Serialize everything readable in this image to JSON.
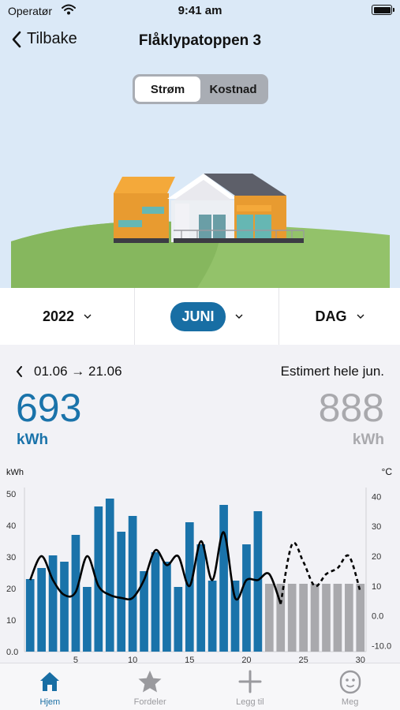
{
  "status": {
    "carrier": "Operatør",
    "time": "9:41 am"
  },
  "nav": {
    "back_label": "Tilbake",
    "title": "Flåklypatoppen 3"
  },
  "view_toggle": {
    "options": [
      "Strøm",
      "Kostnad"
    ],
    "selected": "Strøm"
  },
  "period": {
    "year": "2022",
    "month": "JUNI",
    "resolution": "DAG"
  },
  "summary": {
    "range": "01.06 → 21.06",
    "estimate_label": "Estimert hele jun.",
    "value": "693",
    "unit": "kWh",
    "estimate_value": "888",
    "estimate_unit": "kWh"
  },
  "colors": {
    "accent": "#186ea4",
    "bar_actual": "#1a73aa",
    "bar_estimate": "#a9a9ad",
    "temperature": "#000000"
  },
  "chart_data": {
    "type": "bar",
    "ylabel": "kWh",
    "y2label": "°C",
    "ylim": [
      0,
      52
    ],
    "y2lim": [
      -12,
      43
    ],
    "yticks": [
      "0.0",
      "10",
      "20",
      "30",
      "40",
      "50"
    ],
    "y2ticks": [
      "-10.0",
      "0.0",
      "10",
      "20",
      "30",
      "40"
    ],
    "xticks": [
      "5",
      "10",
      "15",
      "20",
      "25",
      "30"
    ],
    "days": [
      1,
      2,
      3,
      4,
      5,
      6,
      7,
      8,
      9,
      10,
      11,
      12,
      13,
      14,
      15,
      16,
      17,
      18,
      19,
      20,
      21,
      22,
      23,
      24,
      25,
      26,
      27,
      28,
      29,
      30
    ],
    "series": [
      {
        "name": "kWh",
        "values": [
          23,
          26.5,
          30.5,
          28.5,
          37,
          20.5,
          46,
          48.5,
          38,
          43,
          25.5,
          31.5,
          28.5,
          20.5,
          41,
          34,
          22.5,
          46.5,
          22.5,
          34,
          44.5
        ]
      },
      {
        "name": "Estimert",
        "values": [
          21.5,
          21.5,
          21.5,
          21.5,
          21.5,
          21.5,
          21.5,
          21.5,
          21.5
        ]
      },
      {
        "name": "°C",
        "values": [
          12,
          20,
          12,
          7,
          8,
          20,
          10,
          7,
          6,
          6,
          12,
          22,
          17,
          20,
          10,
          25,
          12,
          28,
          6,
          12,
          12,
          14,
          4,
          24,
          18,
          10,
          14,
          16,
          20,
          8
        ]
      }
    ]
  },
  "tabs": [
    {
      "label": "Hjem",
      "icon": "house-icon"
    },
    {
      "label": "Fordeler",
      "icon": "star-icon"
    },
    {
      "label": "Legg til",
      "icon": "plus-icon"
    },
    {
      "label": "Meg",
      "icon": "face-icon"
    }
  ]
}
